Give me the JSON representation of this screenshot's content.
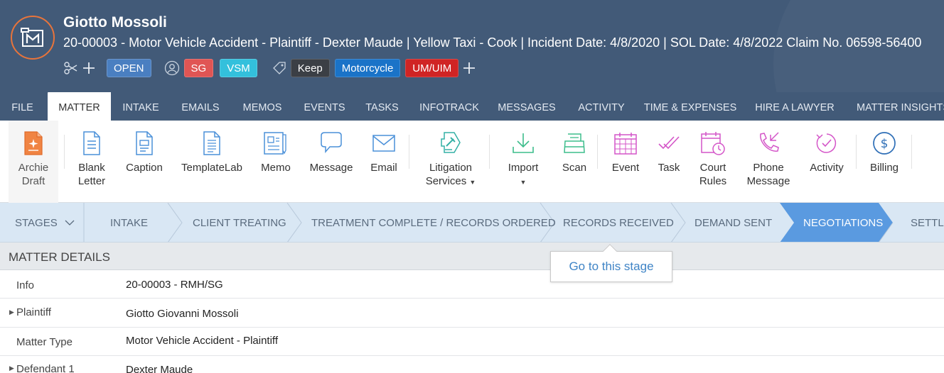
{
  "header": {
    "client_name": "Giotto Mossoli",
    "matter_line": "20-00003 - Motor Vehicle Accident - Plaintiff - Dexter Maude | Yellow Taxi - Cook | Incident Date: 4/8/2020 | SOL Date: 4/8/2022 Claim No. 06598-56400",
    "status_badge": "OPEN",
    "user_tags": [
      {
        "label": "SG",
        "color": "#e05554"
      },
      {
        "label": "VSM",
        "color": "#33c0dc"
      }
    ],
    "label_tags": [
      {
        "label": "Keep",
        "color": "#3b3f45"
      },
      {
        "label": "Motorcycle",
        "color": "#1a73c8"
      },
      {
        "label": "UM/UIM",
        "color": "#d02424"
      }
    ],
    "colors": {
      "header_bg": "#425a78",
      "logo_accent": "#e8743b",
      "open_badge": "#4a7fc1"
    }
  },
  "tabs": [
    "FILE",
    "MATTER",
    "INTAKE",
    "EMAILS",
    "MEMOS",
    "EVENTS",
    "TASKS",
    "INFOTRACK",
    "MESSAGES",
    "ACTIVITY",
    "TIME & EXPENSES",
    "HIRE A LAWYER",
    "MATTER INSIGHTS"
  ],
  "active_tab": "MATTER",
  "ribbon": [
    {
      "label": "Archie\nDraft",
      "icon": "archie-draft-icon"
    },
    {
      "label": "Blank\nLetter",
      "icon": "blank-letter-icon"
    },
    {
      "label": "Caption",
      "icon": "caption-icon"
    },
    {
      "label": "TemplateLab",
      "icon": "templatelab-icon"
    },
    {
      "label": "Memo",
      "icon": "memo-icon"
    },
    {
      "label": "Message",
      "icon": "message-icon"
    },
    {
      "label": "Email",
      "icon": "email-icon"
    },
    {
      "label": "Litigation\nServices",
      "icon": "litigation-services-icon"
    },
    {
      "label": "Import",
      "icon": "import-icon"
    },
    {
      "label": "Scan",
      "icon": "scan-icon"
    },
    {
      "label": "Event",
      "icon": "event-icon"
    },
    {
      "label": "Task",
      "icon": "task-icon"
    },
    {
      "label": "Court\nRules",
      "icon": "court-rules-icon"
    },
    {
      "label": "Phone\nMessage",
      "icon": "phone-message-icon"
    },
    {
      "label": "Activity",
      "icon": "activity-icon"
    },
    {
      "label": "Billing",
      "icon": "billing-icon"
    }
  ],
  "stages": {
    "dropdown_label": "STAGES",
    "items": [
      "INTAKE",
      "CLIENT TREATING",
      "TREATMENT COMPLETE / RECORDS ORDERED",
      "RECORDS RECEIVED",
      "DEMAND SENT",
      "NEGOTIATIONS",
      "SETTLE"
    ],
    "active": "NEGOTIATIONS",
    "tooltip": "Go to this stage",
    "colors": {
      "stage_bg": "#d9e7f4",
      "active_bg": "#5a9ae0"
    }
  },
  "matter_details": {
    "title": "MATTER DETAILS",
    "rows": [
      {
        "label": "Info",
        "value": "20-00003 - RMH/SG"
      },
      {
        "label": "Plaintiff",
        "value": "Giotto Giovanni Mossoli"
      },
      {
        "label": "Matter Type",
        "value": "Motor Vehicle Accident - Plaintiff"
      },
      {
        "label": "Defendant 1",
        "value": "Dexter Maude"
      }
    ]
  }
}
